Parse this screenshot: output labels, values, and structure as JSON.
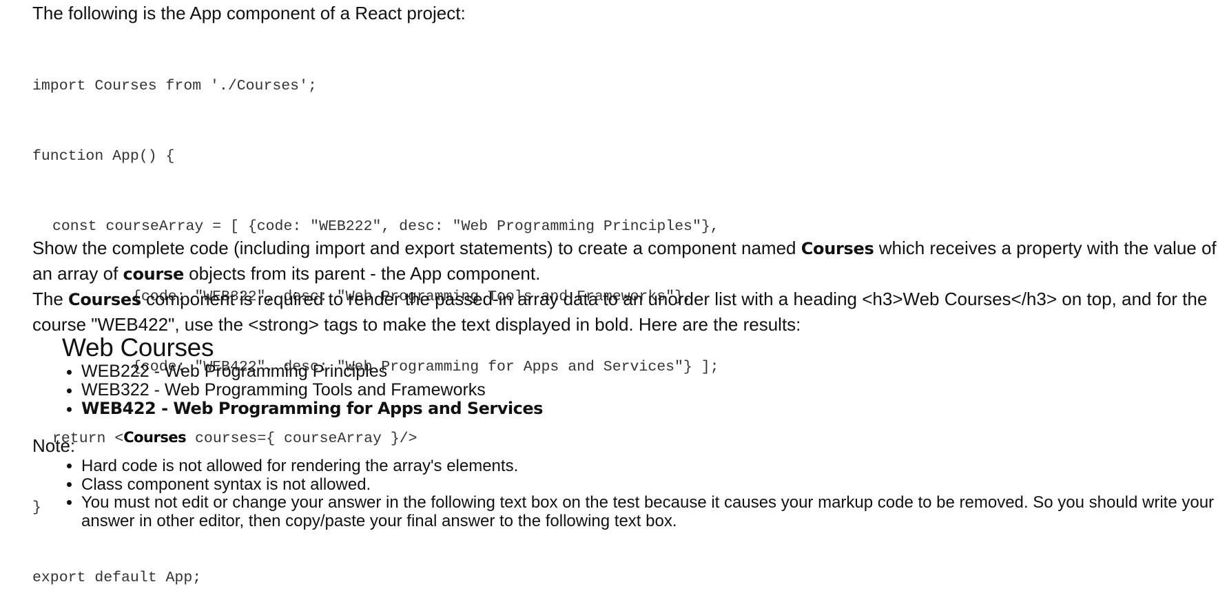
{
  "intro": "The following is the App component of a React project:",
  "code_block": {
    "lines": [
      {
        "text": "import Courses from './Courses';"
      },
      {
        "text": "function App() {"
      },
      {
        "text": "const courseArray = [ {code: \"WEB222\", desc: \"Web Programming Principles\"},"
      },
      {
        "text": "{code: \"WEB322\", desc: \"Web Programming Tools and Frameworks\"},"
      },
      {
        "text": "{code: \"WEB422\", desc: \"Web Programming for Apps and Services\"} ];"
      },
      {
        "pre": "return <",
        "bold": "Courses",
        "post": " courses={ courseArray }/>"
      },
      {
        "text": "}"
      },
      {
        "text": "export default App;"
      }
    ]
  },
  "instructions": {
    "p1_a": "Show the complete code (including import and export statements) to create a component named ",
    "p1_b": "Courses",
    "p1_c": " which receives a property with the value of an array of ",
    "p1_d": "course",
    "p1_e": " objects from its parent - the App component.",
    "p2_a": "The ",
    "p2_b": "Courses",
    "p2_c": " component is required to render the passed-in array data to an unorder list with a heading <h3>Web Courses</h3> on top, and for the course \"WEB422\", use the <strong> tags to make the text displayed in bold. Here are the results:"
  },
  "result": {
    "heading": "Web Courses",
    "items": [
      {
        "text": "WEB222 - Web Programming Principles",
        "bold": false
      },
      {
        "text": "WEB322 - Web Programming Tools and Frameworks",
        "bold": false
      },
      {
        "text": "WEB422 - Web Programming for Apps and Services",
        "bold": true
      }
    ]
  },
  "note": {
    "label": "Note:",
    "items": [
      "Hard code is not allowed for rendering the array's elements.",
      "Class component syntax is not allowed.",
      "You must not edit or change your answer in the following text box on the test because it causes your markup code to be removed. So you should write your answer in other editor, then copy/paste your final answer to the following text box."
    ]
  }
}
